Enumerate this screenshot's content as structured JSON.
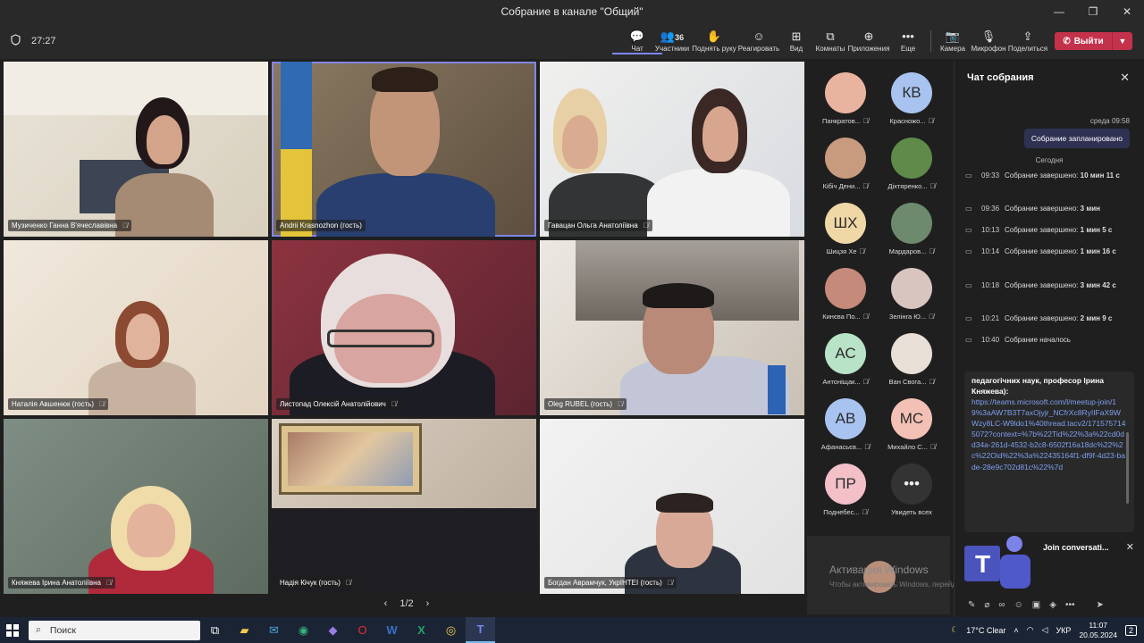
{
  "window": {
    "title": "Собрание в канале \"Общий\""
  },
  "meeting": {
    "timer": "27:27"
  },
  "toolbar": {
    "chat": "Чат",
    "participants": "Участники",
    "participants_count": "36",
    "raise_hand": "Поднять руку",
    "react": "Реагировать",
    "view": "Вид",
    "rooms": "Комнаты",
    "apps": "Приложения",
    "more": "Еще",
    "camera": "Камера",
    "mic": "Микрофон",
    "share": "Поделиться",
    "leave": "Выйти"
  },
  "tiles": [
    {
      "name": "Музиченко Ганна В'ячеславівна"
    },
    {
      "name": "Andrii Krasnozhon (гость)"
    },
    {
      "name": "Гавацан Ольга Анатоліївна"
    },
    {
      "name": "Наталія Авшенюк (гость)"
    },
    {
      "name": "Листопад Олексій Анатолійович"
    },
    {
      "name": "Oleg RUBEL (гость)"
    },
    {
      "name": "Княжева Ірина Анатоліївна"
    },
    {
      "name": "Надія Кічук (гость)"
    },
    {
      "name": "Богдан Аврамчук, УкрІНТЕІ (гость)"
    }
  ],
  "pager": {
    "label": "1/2"
  },
  "roster": [
    {
      "name": "Панкратов...",
      "initials": "",
      "color": "#e8b4a0"
    },
    {
      "name": "Красножо...",
      "initials": "КВ",
      "color": "#a9c3f0"
    },
    {
      "name": "Кібіч Дени...",
      "initials": "",
      "color": "#c89a7e"
    },
    {
      "name": "Діхтяренко...",
      "initials": "",
      "color": "#5f8a4a"
    },
    {
      "name": "Шицзя Хе",
      "initials": "ШХ",
      "color": "#f0d7a6"
    },
    {
      "name": "Мардаров...",
      "initials": "",
      "color": "#6d8a6e"
    },
    {
      "name": "Кинєва По...",
      "initials": "",
      "color": "#c58a7a"
    },
    {
      "name": "Зелінга Ю...",
      "initials": "",
      "color": "#d9c5c0"
    },
    {
      "name": "Антоніщак...",
      "initials": "АС",
      "color": "#b9e3c6"
    },
    {
      "name": "Ван Свога...",
      "initials": "",
      "color": "#e8e0d6"
    },
    {
      "name": "Афанасьєв...",
      "initials": "АВ",
      "color": "#a9c3f0"
    },
    {
      "name": "Михайло С...",
      "initials": "МС",
      "color": "#f3c0b5"
    },
    {
      "name": "Поднебес...",
      "initials": "ПР",
      "color": "#f3c0c8"
    },
    {
      "name": "Увидеть всех",
      "initials": "•••",
      "color": "#333333"
    }
  ],
  "windows_watermark": {
    "title": "Активация Windows",
    "subtitle": "Чтобы активировать Windows, перейдите в раздел «Параметры»."
  },
  "chat": {
    "header": "Чат собрания",
    "day_label": "среда 09:58",
    "bubble": "Собрание запланировано",
    "today_label": "Сегодня",
    "events": [
      {
        "time": "09:33",
        "text": "Собрание завершено:",
        "bold": "10 мин 11 с"
      },
      {
        "time": "09:36",
        "text": "Собрание завершено:",
        "bold": "3 мин"
      },
      {
        "time": "10:13",
        "text": "Собрание завершено:",
        "bold": "1 мин 5 с"
      },
      {
        "time": "10:14",
        "text": "Собрание завершено:",
        "bold": "1 мин 16 с"
      },
      {
        "time": "10:18",
        "text": "Собрание завершено:",
        "bold": "3 мин 42 с"
      },
      {
        "time": "10:21",
        "text": "Собрание завершено:",
        "bold": "2 мин 9 с"
      },
      {
        "time": "10:40",
        "text": "Собрание началось",
        "bold": ""
      }
    ],
    "message_text": "педагогічних наук, професор Ірина Княжева):",
    "message_link": "https://teams.microsoft.com/l/meetup-join/19%3aAW7B3T7axOjyjr_NCfrXc8RyIIFaX9WWzy8LC-W9ldo1%40thread.tacv2/1715757145072?context=%7b%22Tid%22%3a%22cd0dd34a-261d-4532-b2c8-6502f16a18dc%22%2c%22Oid%22%3a%22435164f1-df9f-4d23-bade-28e9c702d81c%22%7d",
    "join_title": "Join conversati..."
  },
  "taskbar": {
    "search": "Поиск",
    "weather": "17°C  Clear",
    "lang": "УКР",
    "time": "11:07",
    "date": "20.05.2024",
    "notifications": "2"
  }
}
